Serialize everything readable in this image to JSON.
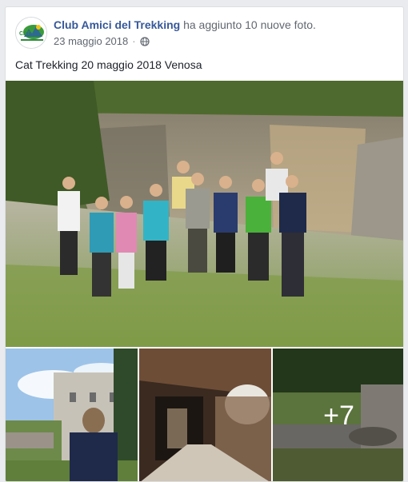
{
  "post": {
    "author": "Club Amici del Trekking",
    "action": "ha aggiunto 10 nuove foto.",
    "date": "23 maggio 2018",
    "separator": "·",
    "privacy_icon": "globe-icon",
    "text": "Cat Trekking 20 maggio 2018 Venosa",
    "avatar_label": "CAT"
  },
  "photos": {
    "main_alt": "group photo",
    "more_count": "+7"
  },
  "colors": {
    "link": "#365899",
    "meta": "#616770",
    "text": "#1d2129",
    "background": "#e9ebee"
  }
}
